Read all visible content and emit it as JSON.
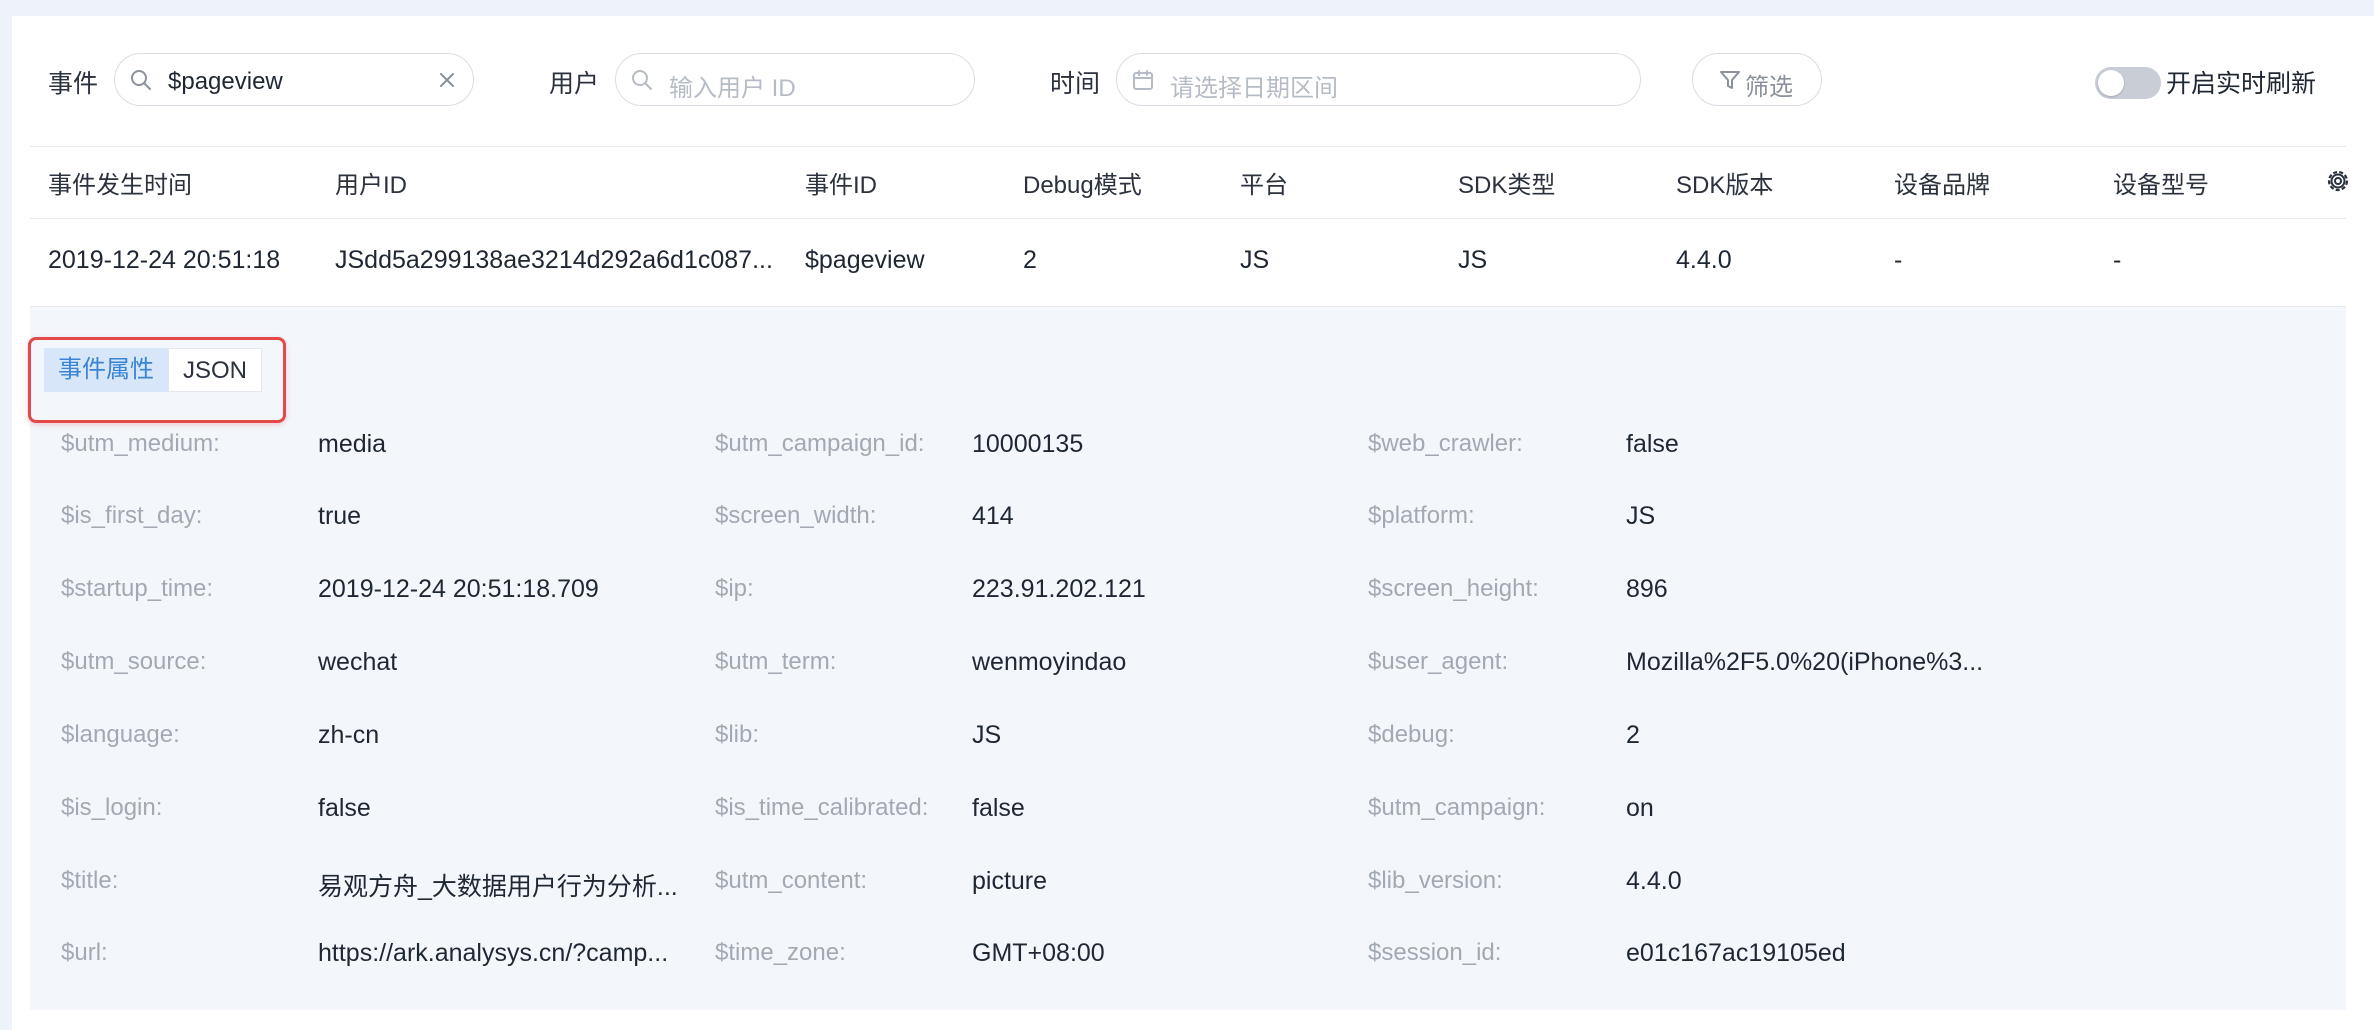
{
  "filters": {
    "event_label": "事件",
    "event_value": "$pageview",
    "user_label": "用户",
    "user_placeholder": "输入用户 ID",
    "time_label": "时间",
    "time_placeholder": "请选择日期区间",
    "filter_button": "筛选",
    "realtime_label": "开启实时刷新",
    "realtime_on": false
  },
  "table": {
    "columns": [
      "事件发生时间",
      "用户ID",
      "事件ID",
      "Debug模式",
      "平台",
      "SDK类型",
      "SDK版本",
      "设备品牌",
      "设备型号"
    ],
    "rows": [
      [
        "2019-12-24 20:51:18",
        "JSdd5a299138ae3214d292a6d1c087...",
        "$pageview",
        "2",
        "JS",
        "JS",
        "4.4.0",
        "-",
        "-"
      ]
    ]
  },
  "detail": {
    "tabs": [
      {
        "label": "事件属性",
        "active": true
      },
      {
        "label": "JSON",
        "active": false
      }
    ],
    "properties": [
      [
        {
          "key": "$utm_medium:",
          "value": "media"
        },
        {
          "key": "$utm_campaign_id:",
          "value": "10000135"
        },
        {
          "key": "$web_crawler:",
          "value": "false"
        }
      ],
      [
        {
          "key": "$is_first_day:",
          "value": "true"
        },
        {
          "key": "$screen_width:",
          "value": "414"
        },
        {
          "key": "$platform:",
          "value": "JS"
        }
      ],
      [
        {
          "key": "$startup_time:",
          "value": "2019-12-24 20:51:18.709"
        },
        {
          "key": "$ip:",
          "value": "223.91.202.121"
        },
        {
          "key": "$screen_height:",
          "value": "896"
        }
      ],
      [
        {
          "key": "$utm_source:",
          "value": "wechat"
        },
        {
          "key": "$utm_term:",
          "value": "wenmoyindao"
        },
        {
          "key": "$user_agent:",
          "value": "Mozilla%2F5.0%20(iPhone%3..."
        }
      ],
      [
        {
          "key": "$language:",
          "value": "zh-cn"
        },
        {
          "key": "$lib:",
          "value": "JS"
        },
        {
          "key": "$debug:",
          "value": "2"
        }
      ],
      [
        {
          "key": "$is_login:",
          "value": "false"
        },
        {
          "key": "$is_time_calibrated:",
          "value": "false"
        },
        {
          "key": "$utm_campaign:",
          "value": "on"
        }
      ],
      [
        {
          "key": "$title:",
          "value": "易观方舟_大数据用户行为分析..."
        },
        {
          "key": "$utm_content:",
          "value": "picture"
        },
        {
          "key": "$lib_version:",
          "value": "4.4.0"
        }
      ],
      [
        {
          "key": "$url:",
          "value": "https://ark.analysys.cn/?camp..."
        },
        {
          "key": "$time_zone:",
          "value": "GMT+08:00"
        },
        {
          "key": "$session_id:",
          "value": "e01c167ac19105ed"
        }
      ]
    ]
  },
  "colors": {
    "accent": "#3a84d6",
    "highlight_box": "#e24a4a",
    "detail_bg": "#f3f7fc",
    "page_bg": "#eef3fb"
  }
}
